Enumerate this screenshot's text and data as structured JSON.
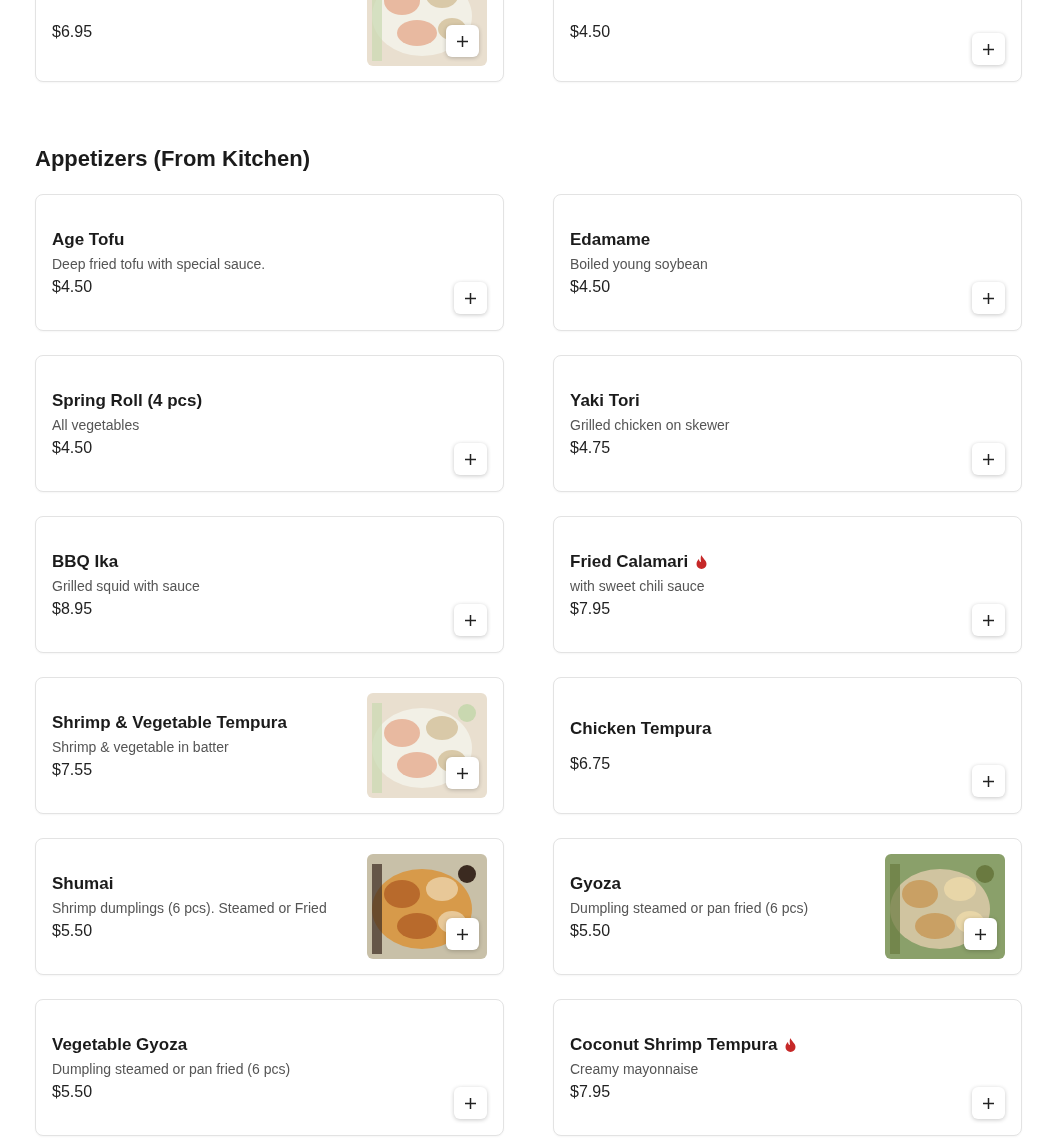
{
  "sections": [
    {
      "items": [
        {
          "price": "$6.95",
          "spicy": false
        },
        {
          "price": "$4.50",
          "spicy": false
        }
      ]
    },
    {
      "title": "Appetizers (From Kitchen)",
      "items": [
        {
          "name": "Age Tofu",
          "description": "Deep fried tofu with special sauce.",
          "price": "$4.50",
          "spicy": false
        },
        {
          "name": "Edamame",
          "description": "Boiled young soybean",
          "price": "$4.50",
          "spicy": false
        },
        {
          "name": "Spring Roll (4 pcs)",
          "description": "All vegetables",
          "price": "$4.50",
          "spicy": false
        },
        {
          "name": "Yaki Tori",
          "description": "Grilled chicken on skewer",
          "price": "$4.75",
          "spicy": false
        },
        {
          "name": "BBQ Ika",
          "description": "Grilled squid with sauce",
          "price": "$8.95",
          "spicy": false
        },
        {
          "name": "Fried Calamari",
          "description": "with sweet chili sauce",
          "price": "$7.95",
          "spicy": true
        },
        {
          "name": "Shrimp & Vegetable Tempura",
          "description": "Shrimp & vegetable in batter",
          "price": "$7.55",
          "spicy": false
        },
        {
          "name": "Chicken Tempura",
          "price": "$6.75",
          "spicy": false
        },
        {
          "name": "Shumai",
          "description": "Shrimp dumplings (6 pcs). Steamed or Fried",
          "price": "$5.50",
          "spicy": false
        },
        {
          "name": "Gyoza",
          "description": "Dumpling steamed or pan fried (6 pcs)",
          "price": "$5.50",
          "spicy": false
        },
        {
          "name": "Vegetable Gyoza",
          "description": "Dumpling steamed or pan fried (6 pcs)",
          "price": "$5.50",
          "spicy": false
        },
        {
          "name": "Coconut Shrimp Tempura",
          "description": "Creamy mayonnaise",
          "price": "$7.95",
          "spicy": true
        }
      ]
    }
  ]
}
